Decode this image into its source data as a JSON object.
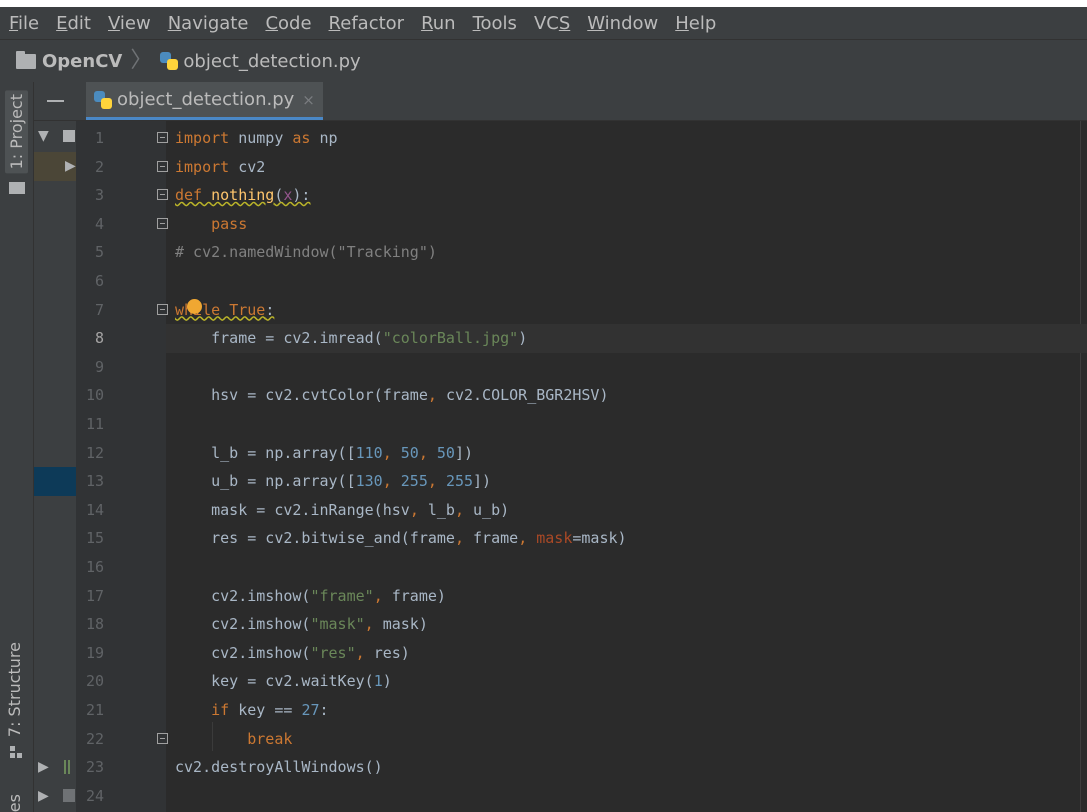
{
  "menu": [
    {
      "mnemonic": "F",
      "rest": "ile"
    },
    {
      "mnemonic": "E",
      "rest": "dit"
    },
    {
      "mnemonic": "V",
      "rest": "iew"
    },
    {
      "mnemonic": "N",
      "rest": "avigate"
    },
    {
      "mnemonic": "C",
      "rest": "ode"
    },
    {
      "mnemonic": "R",
      "rest": "efactor"
    },
    {
      "mnemonic": "R",
      "rest": "un",
      "pre": ""
    },
    {
      "mnemonic": "T",
      "rest": "ools"
    },
    {
      "mnemonic": "S",
      "rest": "",
      "pre": "VC"
    },
    {
      "mnemonic": "W",
      "rest": "indow"
    },
    {
      "mnemonic": "H",
      "rest": "elp"
    }
  ],
  "breadcrumb": {
    "project": "OpenCV",
    "file": "object_detection.py"
  },
  "tool_window_tabs": {
    "project": "1: Project",
    "structure": "7: Structure",
    "favorites": "es"
  },
  "editor": {
    "tab_label": "object_detection.py",
    "tab_close": "×",
    "current_line": 8,
    "line_numbers": [
      "1",
      "2",
      "3",
      "4",
      "5",
      "6",
      "7",
      "8",
      "9",
      "10",
      "11",
      "12",
      "13",
      "14",
      "15",
      "16",
      "17",
      "18",
      "19",
      "20",
      "21",
      "22",
      "23",
      "24"
    ],
    "lines": [
      [
        [
          "import",
          "kw"
        ],
        [
          " numpy ",
          ""
        ],
        [
          "as",
          "kw"
        ],
        [
          " np",
          ""
        ]
      ],
      [
        [
          "import",
          "kw"
        ],
        [
          " cv2",
          ""
        ]
      ],
      [
        [
          "def",
          "kw"
        ],
        [
          " ",
          ""
        ],
        [
          "nothing",
          "fn"
        ],
        [
          "(",
          ""
        ],
        [
          "x",
          "param"
        ],
        [
          "):",
          ""
        ]
      ],
      [
        [
          "    ",
          ""
        ],
        [
          "pass",
          "kw"
        ]
      ],
      [
        [
          "# cv2.namedWindow(\"Tracking\")",
          "cm"
        ]
      ],
      [],
      [
        [
          "while",
          "kw"
        ],
        [
          " ",
          ""
        ],
        [
          "True",
          "kw"
        ],
        [
          ":",
          ""
        ]
      ],
      [
        [
          "    frame = cv2.imread(",
          ""
        ],
        [
          "\"colorBall.jpg\"",
          "str"
        ],
        [
          ")",
          ""
        ]
      ],
      [],
      [
        [
          "    hsv = cv2.cvtColor(frame",
          ""
        ],
        [
          ", ",
          "kw"
        ],
        [
          "cv2.COLOR_BGR2HSV)",
          ""
        ]
      ],
      [],
      [
        [
          "    l_b = np.array([",
          ""
        ],
        [
          "110",
          "num"
        ],
        [
          ", ",
          "kw"
        ],
        [
          "50",
          "num"
        ],
        [
          ", ",
          "kw"
        ],
        [
          "50",
          "num"
        ],
        [
          "])",
          ""
        ]
      ],
      [
        [
          "    u_b = np.array([",
          ""
        ],
        [
          "130",
          "num"
        ],
        [
          ", ",
          "kw"
        ],
        [
          "255",
          "num"
        ],
        [
          ", ",
          "kw"
        ],
        [
          "255",
          "num"
        ],
        [
          "])",
          ""
        ]
      ],
      [
        [
          "    mask = cv2.inRange(hsv",
          ""
        ],
        [
          ", ",
          "kw"
        ],
        [
          "l_b",
          ""
        ],
        [
          ", ",
          "kw"
        ],
        [
          "u_b)",
          ""
        ]
      ],
      [
        [
          "    res = cv2.bitwise_and(frame",
          ""
        ],
        [
          ", ",
          "kw"
        ],
        [
          "frame",
          ""
        ],
        [
          ", ",
          "kw"
        ],
        [
          "mask",
          "arg"
        ],
        [
          "=mask)",
          ""
        ]
      ],
      [],
      [
        [
          "    cv2.imshow(",
          ""
        ],
        [
          "\"frame\"",
          "str"
        ],
        [
          ", ",
          "kw"
        ],
        [
          "frame)",
          ""
        ]
      ],
      [
        [
          "    cv2.imshow(",
          ""
        ],
        [
          "\"mask\"",
          "str"
        ],
        [
          ", ",
          "kw"
        ],
        [
          "mask)",
          ""
        ]
      ],
      [
        [
          "    cv2.imshow(",
          ""
        ],
        [
          "\"res\"",
          "str"
        ],
        [
          ", ",
          "kw"
        ],
        [
          "res)",
          ""
        ]
      ],
      [
        [
          "    key = cv2.waitKey(",
          ""
        ],
        [
          "1",
          "num"
        ],
        [
          ")",
          ""
        ]
      ],
      [
        [
          "    ",
          ""
        ],
        [
          "if",
          "kw"
        ],
        [
          " key == ",
          ""
        ],
        [
          "27",
          "num"
        ],
        [
          ":",
          ""
        ]
      ],
      [
        [
          "        ",
          ""
        ],
        [
          "break",
          "kw"
        ]
      ],
      [
        [
          "cv2.destroyAllWindows()",
          ""
        ]
      ],
      []
    ]
  },
  "colors": {
    "background": "#2b2b2b",
    "keyword": "#cc7832",
    "number": "#6897bb",
    "string": "#6a8759",
    "comment": "#808080",
    "function": "#ffc66d",
    "intention_bulb": "#f0a732"
  }
}
